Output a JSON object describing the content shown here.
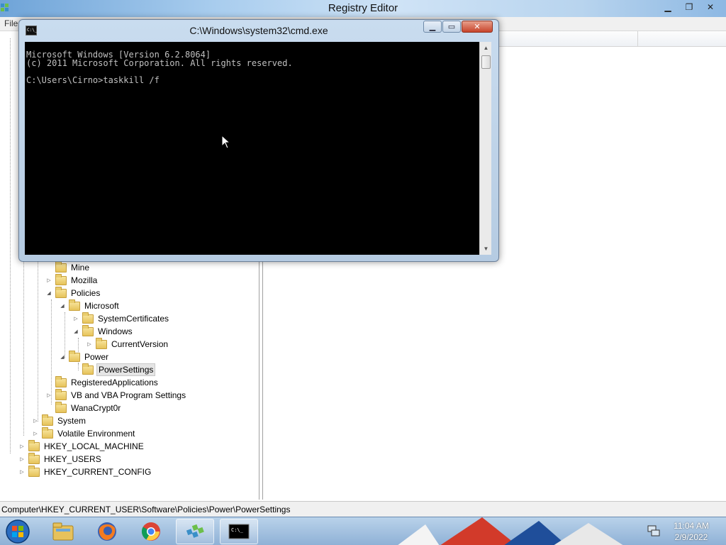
{
  "registry_editor": {
    "title": "Registry Editor",
    "menu_first": "File",
    "status_path": "Computer\\HKEY_CURRENT_USER\\Software\\Policies\\Power\\PowerSettings",
    "tree_nodes": [
      {
        "label": "Mine",
        "expander": "collapsed-none"
      },
      {
        "label": "Mozilla",
        "expander": "collapsed"
      },
      {
        "label": "Policies",
        "expander": "expanded"
      },
      {
        "label": "Microsoft",
        "expander": "expanded"
      },
      {
        "label": "SystemCertificates",
        "expander": "collapsed"
      },
      {
        "label": "Windows",
        "expander": "expanded"
      },
      {
        "label": "CurrentVersion",
        "expander": "collapsed"
      },
      {
        "label": "Power",
        "expander": "expanded"
      },
      {
        "label": "PowerSettings",
        "expander": "none",
        "selected": true
      },
      {
        "label": "RegisteredApplications",
        "expander": "none"
      },
      {
        "label": "VB and VBA Program Settings",
        "expander": "collapsed"
      },
      {
        "label": "WanaCrypt0r",
        "expander": "none"
      },
      {
        "label": "System",
        "expander": "collapsed"
      },
      {
        "label": "Volatile Environment",
        "expander": "collapsed"
      },
      {
        "label": "HKEY_LOCAL_MACHINE",
        "expander": "collapsed"
      },
      {
        "label": "HKEY_USERS",
        "expander": "collapsed"
      },
      {
        "label": "HKEY_CURRENT_CONFIG",
        "expander": "collapsed"
      }
    ]
  },
  "cmd": {
    "title": "C:\\Windows\\system32\\cmd.exe",
    "icon_text": "C:\\_",
    "lines": [
      "Microsoft Windows [Version 6.2.8064]",
      "(c) 2011 Microsoft Corporation. All rights reserved.",
      "",
      "C:\\Users\\Cirno>taskkill /f"
    ]
  },
  "taskbar": {
    "apps": [
      "start-orb-icon",
      "file-explorer-icon",
      "firefox-icon",
      "chrome-icon",
      "regedit-icon",
      "cmd-icon"
    ],
    "time": "11:04 AM",
    "date": "2/9/2022"
  },
  "colors": {
    "console_bg": "#000000",
    "console_text": "#c0c0c0",
    "selection_bg": "#e5e5e5"
  }
}
